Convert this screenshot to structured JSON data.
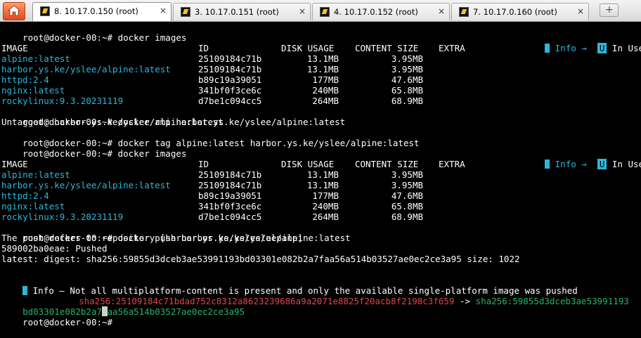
{
  "tabs": [
    {
      "label": "8. 10.17.0.150 (root)",
      "active": true,
      "close": "×"
    },
    {
      "label": "3. 10.17.0.151 (root)",
      "active": false,
      "close": "×"
    },
    {
      "label": "4. 10.17.0.152 (root)",
      "active": false,
      "close": "×"
    },
    {
      "label": "7. 10.17.0.160 (root)",
      "active": false,
      "close": "×"
    }
  ],
  "new_tab_symbol": "+",
  "terminal": {
    "prompt": "root@docker-00:~#",
    "cmd1": "docker images",
    "legend_info": "Info →",
    "legend_u": "U",
    "legend_inuse": "In Use",
    "headers": {
      "image": "IMAGE",
      "id": "ID",
      "disk": "DISK USAGE",
      "content": "CONTENT SIZE",
      "extra": "EXTRA"
    },
    "images1": [
      {
        "name": "alpine:latest",
        "id": "25109184c71b",
        "disk": "13.1MB",
        "content": "3.95MB"
      },
      {
        "name": "harbor.ys.ke/yslee/alpine:latest",
        "id": "25109184c71b",
        "disk": "13.1MB",
        "content": "3.95MB"
      },
      {
        "name": "httpd:2.4",
        "id": "b89c19a39051",
        "disk": "177MB",
        "content": "47.6MB"
      },
      {
        "name": "nginx:latest",
        "id": "341bf0f3ce6c",
        "disk": "240MB",
        "content": "65.8MB"
      },
      {
        "name": "rockylinux:9.3.20231119",
        "id": "d7be1c094cc5",
        "disk": "264MB",
        "content": "68.9MB"
      }
    ],
    "cmd2": "docker rmi harbor.ys.ke/yslee/alpine:latest",
    "untagged": "Untagged: harbor.ys.ke/yslee/alpine:latest",
    "cmd3": "docker tag alpine:latest harbor.ys.ke/yslee/alpine:latest",
    "cmd4": "docker images",
    "images2": [
      {
        "name": "alpine:latest",
        "id": "25109184c71b",
        "disk": "13.1MB",
        "content": "3.95MB"
      },
      {
        "name": "harbor.ys.ke/yslee/alpine:latest",
        "id": "25109184c71b",
        "disk": "13.1MB",
        "content": "3.95MB"
      },
      {
        "name": "httpd:2.4",
        "id": "b89c19a39051",
        "disk": "177MB",
        "content": "47.6MB"
      },
      {
        "name": "nginx:latest",
        "id": "341bf0f3ce6c",
        "disk": "240MB",
        "content": "65.8MB"
      },
      {
        "name": "rockylinux:9.3.20231119",
        "id": "d7be1c094cc5",
        "disk": "264MB",
        "content": "68.9MB"
      }
    ],
    "cmd5": "docker push harbor.ys.ke/yslee/alpine:latest",
    "push_refers": "The push refers to repository [harbor.ys.ke/yslee/alpine]",
    "pushed": "589002ba0eae: Pushed",
    "digest": "latest: digest: sha256:59855d3dceb3ae53991193bd03301e082b2a7faa56a514b03527ae0ec2ce3a95 size: 1022",
    "info_msg": "Info – Not all multiplatform-content is present and only the available single-platform image was pushed",
    "sha_from": "sha256:25109184c71bdad752c8312a8623239686a9a2071e8825f20acb8f2198c3f659",
    "arrow": " -> ",
    "sha_to_part1": "sha256:59855d3dceb3ae53991193",
    "sha_to_part2": "bd03301e082b2a7faa56a514b03527ae0ec2ce3a95"
  },
  "colors": {
    "cyan": "#29b8db",
    "red": "#e0454f",
    "green": "#23b36f",
    "background": "#000000"
  }
}
